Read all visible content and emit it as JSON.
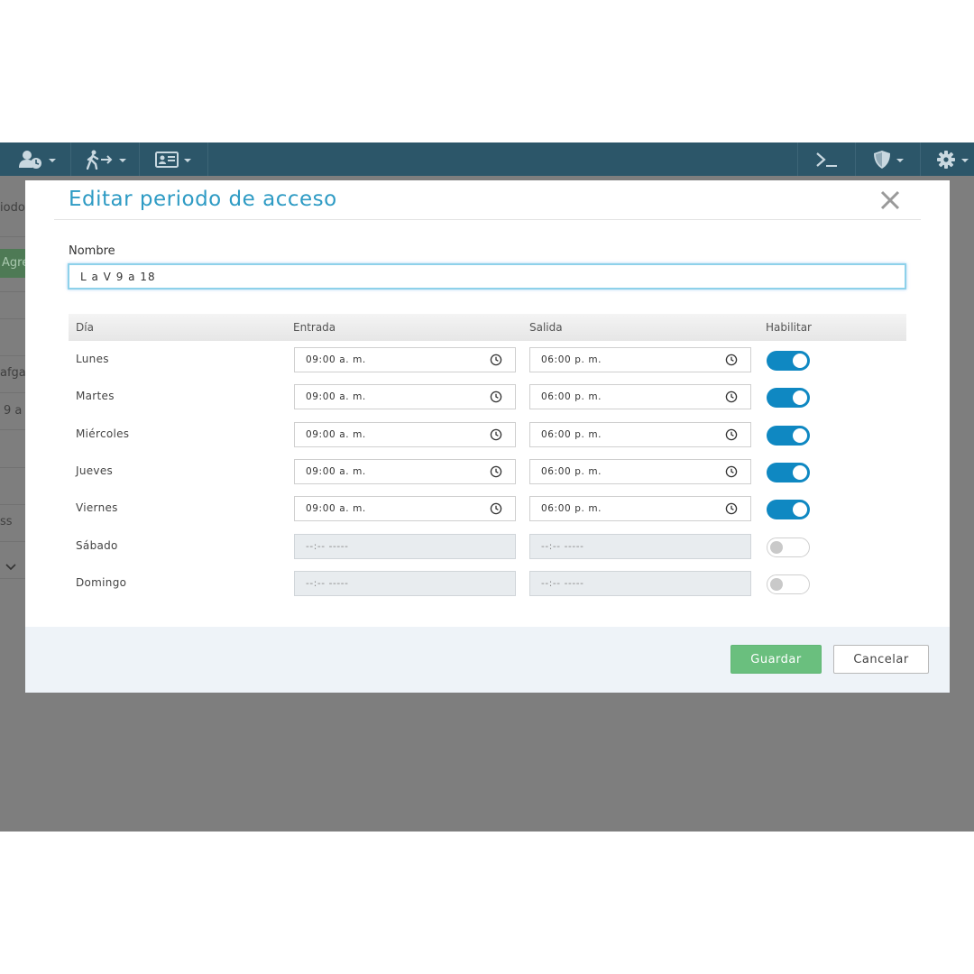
{
  "background": {
    "fragments": [
      "iodo",
      "Agre",
      "afgas",
      "9 a",
      "ss"
    ]
  },
  "navbar": {
    "icons": [
      "user-clock-icon",
      "person-walking-arrow-icon",
      "id-card-icon",
      "terminal-icon",
      "shield-icon",
      "gear-icon"
    ]
  },
  "modal": {
    "title": "Editar periodo de acceso",
    "name_label": "Nombre",
    "name_value": "L a V 9 a 18",
    "columns": [
      "Día",
      "Entrada",
      "Salida",
      "Habilitar"
    ],
    "rows": [
      {
        "day": "Lunes",
        "entrada": "09:00  a. m.",
        "salida": "06:00  p. m.",
        "enabled": true
      },
      {
        "day": "Martes",
        "entrada": "09:00  a. m.",
        "salida": "06:00  p. m.",
        "enabled": true
      },
      {
        "day": "Miércoles",
        "entrada": "09:00  a. m.",
        "salida": "06:00  p. m.",
        "enabled": true
      },
      {
        "day": "Jueves",
        "entrada": "09:00  a. m.",
        "salida": "06:00  p. m.",
        "enabled": true
      },
      {
        "day": "Viernes",
        "entrada": "09:00  a. m.",
        "salida": "06:00  p. m.",
        "enabled": true
      },
      {
        "day": "Sábado",
        "entrada": "--:--  -----",
        "salida": "--:--  -----",
        "enabled": false
      },
      {
        "day": "Domingo",
        "entrada": "--:--  -----",
        "salida": "--:--  -----",
        "enabled": false
      }
    ],
    "buttons": {
      "save": "Guardar",
      "cancel": "Cancelar"
    }
  },
  "colors": {
    "navbar": "#2c5669",
    "accent": "#2e9bc4",
    "toggle_on": "#0f88c2",
    "save_button": "#6abf7e",
    "footer": "#eef3f8",
    "overlay": "#7e7e7e"
  }
}
